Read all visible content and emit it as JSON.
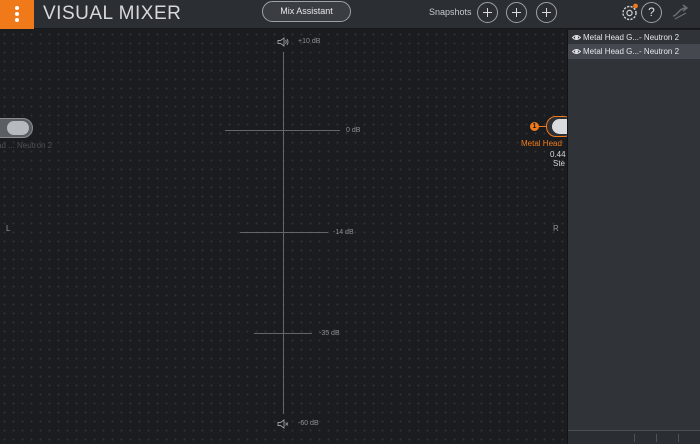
{
  "header": {
    "title": "VISUAL MIXER",
    "mix_assistant_label": "Mix Assistant",
    "snapshots_label": "Snapshots",
    "help_label": "?"
  },
  "mixer": {
    "db_labels": {
      "top": "+10 dB",
      "zero": "0 dB",
      "m14": "-14 dB",
      "m35": "-35 dB",
      "bottom": "-60 dB"
    },
    "pan_left": "L",
    "pan_right": "R",
    "left_node_label": "ad ... Neutron 2",
    "right_node": {
      "badge": "1",
      "name": "Metal Head",
      "value": "0.44",
      "mode": "Ste"
    }
  },
  "tracks": [
    {
      "name": "Metal Head G...- Neutron 2",
      "selected": false
    },
    {
      "name": "Metal Head G...- Neutron 2",
      "selected": true
    }
  ],
  "colors": {
    "accent": "#f07a1a",
    "background": "#1a1c1f",
    "panel": "#303338"
  },
  "icons": {
    "speaker_top": "speaker-icon",
    "speaker_bottom": "speaker-mute-icon",
    "settings": "gear-icon",
    "visibility": "eye-icon"
  }
}
